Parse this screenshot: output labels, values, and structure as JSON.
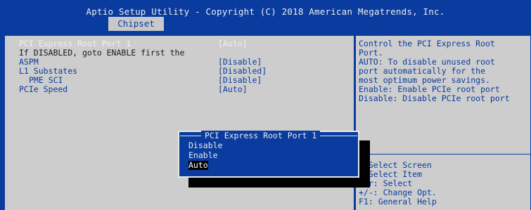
{
  "header": {
    "title": "Aptio Setup Utility - Copyright (C) 2018 American Megatrends, Inc.",
    "active_tab": "Chipset"
  },
  "settings": [
    {
      "label": "PCI Express Root Port 1",
      "value": "[Auto]",
      "state": "selected"
    },
    {
      "label": "If DISABLED, goto ENABLE first the",
      "value": "",
      "state": "note"
    },
    {
      "label": "ASPM",
      "value": "[Disable]",
      "state": "normal"
    },
    {
      "label": "L1 Substates",
      "value": "[Disabled]",
      "state": "normal"
    },
    {
      "label": "PME SCI",
      "value": "[Disable]",
      "state": "indent"
    },
    {
      "label": "PCIe Speed",
      "value": "[Auto]",
      "state": "normal"
    }
  ],
  "help_text": [
    "Control the PCI Express Root",
    "Port.",
    "AUTO: To disable unused root",
    "port automatically for the",
    "most optimum power savings.",
    "Enable: Enable PCIe root port",
    "Disable: Disable PCIe root port"
  ],
  "keys": [
    ": Select Screen",
    ": Select Item",
    "ter: Select",
    "+/-: Change Opt.",
    "F1: General Help"
  ],
  "popup": {
    "title": "PCI Express Root Port 1",
    "options": [
      "Disable",
      "Enable",
      "Auto"
    ],
    "selected": "Auto"
  },
  "colors": {
    "bios_blue": "#0a3ca0",
    "panel_gray": "#cdcdcd",
    "highlight_text": "#f0f0f0"
  }
}
